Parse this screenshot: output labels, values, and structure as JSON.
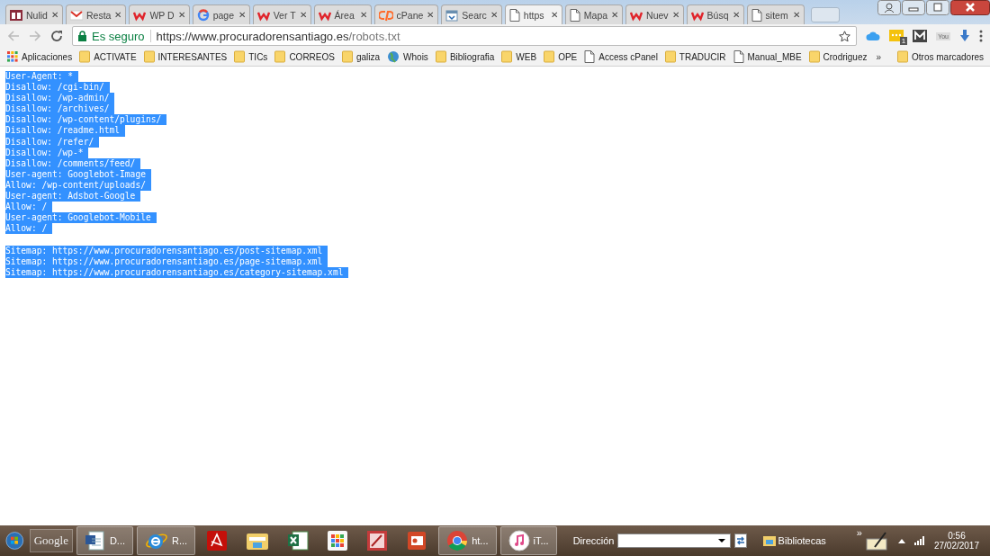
{
  "tabs": [
    {
      "kind": "scales",
      "title": "Nulid",
      "selected": false
    },
    {
      "kind": "gmail",
      "title": "Resta",
      "selected": false
    },
    {
      "kind": "w",
      "title": "WP D",
      "selected": false
    },
    {
      "kind": "google",
      "title": "page",
      "selected": false
    },
    {
      "kind": "w",
      "title": "Ver T",
      "selected": false
    },
    {
      "kind": "w",
      "title": "Área",
      "selected": false
    },
    {
      "kind": "cpanel",
      "title": "cPane",
      "selected": false
    },
    {
      "kind": "calendar",
      "title": "Searc",
      "selected": false
    },
    {
      "kind": "page",
      "title": "https",
      "selected": true
    },
    {
      "kind": "page",
      "title": "Mapa",
      "selected": false
    },
    {
      "kind": "w",
      "title": "Nuev",
      "selected": false
    },
    {
      "kind": "w",
      "title": "Búsq",
      "selected": false
    },
    {
      "kind": "page",
      "title": "sitem",
      "selected": false
    }
  ],
  "close_glyph": "✕",
  "address": {
    "secure_label": "Es seguro",
    "host": "https://www.procuradorensantiago.es",
    "path": "/robots.txt"
  },
  "bookmarks": [
    {
      "kind": "apps",
      "label": "Aplicaciones"
    },
    {
      "kind": "folder",
      "label": "ACTIVATE"
    },
    {
      "kind": "folder",
      "label": "INTERESANTES"
    },
    {
      "kind": "folder",
      "label": "TICs"
    },
    {
      "kind": "folder",
      "label": "CORREOS"
    },
    {
      "kind": "folder",
      "label": "galiza"
    },
    {
      "kind": "globe",
      "label": "Whois"
    },
    {
      "kind": "folder",
      "label": "Bibliografia"
    },
    {
      "kind": "folder",
      "label": "WEB"
    },
    {
      "kind": "folder",
      "label": "OPE"
    },
    {
      "kind": "page",
      "label": "Access cPanel"
    },
    {
      "kind": "folder",
      "label": "TRADUCIR"
    },
    {
      "kind": "page",
      "label": "Manual_MBE"
    },
    {
      "kind": "folder",
      "label": "Crodriguez"
    }
  ],
  "bookmarks_more": "»",
  "other_bookmarks": "Otros marcadores",
  "extension_badge": "1",
  "youtube_label": "You",
  "content": {
    "blocks": [
      {
        "selected": true,
        "lines": [
          "User-Agent: *",
          "Disallow: /cgi-bin/",
          "Disallow: /wp-admin/",
          "Disallow: /archives/",
          "Disallow: /wp-content/plugins/",
          "Disallow: /readme.html",
          "Disallow: /refer/",
          "Disallow: /wp-*",
          "Disallow: /comments/feed/",
          "User-agent: Googlebot-Image",
          "Allow: /wp-content/uploads/",
          "User-agent: Adsbot-Google",
          "Allow: /",
          "User-agent: Googlebot-Mobile",
          "Allow: /"
        ]
      },
      {
        "selected": true,
        "lines": [
          "Sitemap: https://www.procuradorensantiago.es/post-sitemap.xml",
          "Sitemap: https://www.procuradorensantiago.es/page-sitemap.xml",
          "Sitemap: https://www.procuradorensantiago.es/category-sitemap.xml"
        ]
      }
    ]
  },
  "taskbar": {
    "search_label": "Google",
    "items": [
      {
        "kind": "word",
        "label": "D...",
        "open": true
      },
      {
        "kind": "ie",
        "label": "R...",
        "open": true
      },
      {
        "kind": "acrobat",
        "open": false
      },
      {
        "kind": "explorer",
        "open": false
      },
      {
        "kind": "excel",
        "open": false
      },
      {
        "kind": "apps",
        "open": false
      },
      {
        "kind": "access",
        "open": false
      },
      {
        "kind": "powerpoint",
        "open": false
      },
      {
        "kind": "chrome",
        "label": "ht...",
        "open": true
      },
      {
        "kind": "itunes",
        "label": "iT...",
        "open": true
      }
    ],
    "address_label": "Dirección",
    "libraries": "Bibliotecas",
    "more": "»",
    "time": "0:56",
    "date": "27/02/2017"
  }
}
